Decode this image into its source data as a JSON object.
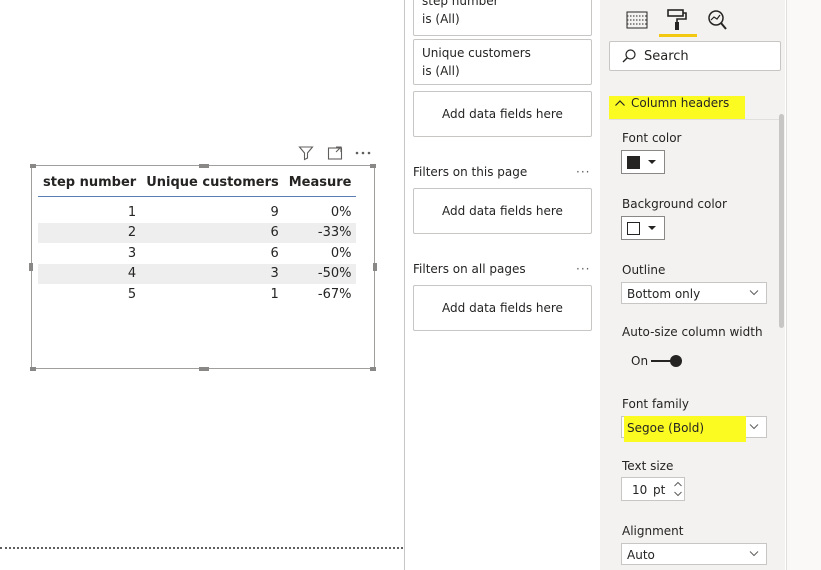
{
  "visual_table": {
    "columns": [
      "step number",
      "Unique customers",
      "Measure"
    ],
    "rows": [
      [
        "1",
        "9",
        "0%"
      ],
      [
        "2",
        "6",
        "-33%"
      ],
      [
        "3",
        "6",
        "0%"
      ],
      [
        "4",
        "3",
        "-50%"
      ],
      [
        "5",
        "1",
        "-67%"
      ]
    ]
  },
  "filters_pane": {
    "cards": [
      {
        "line1": "step number",
        "line2": "is (All)"
      },
      {
        "line1": "Unique customers",
        "line2": "is (All)"
      }
    ],
    "add_fields_label": "Add data fields here",
    "page_filters_label": "Filters on this page",
    "all_pages_label": "Filters on all pages",
    "more_label": "···"
  },
  "format_pane": {
    "search_placeholder": "Search",
    "section_title": "Column headers",
    "font_color_label": "Font color",
    "font_color": "#252423",
    "background_color_label": "Background color",
    "background_color": "#ffffff",
    "outline_label": "Outline",
    "outline_value": "Bottom only",
    "autosize_label": "Auto-size column width",
    "autosize_value": "On",
    "font_family_label": "Font family",
    "font_family_value": "Segoe (Bold)",
    "text_size_label": "Text size",
    "text_size_value": "10",
    "text_size_unit": "pt",
    "alignment_label": "Alignment",
    "alignment_value": "Auto",
    "highlight_color": "#fbfb22",
    "accent_color": "#f2c811"
  }
}
